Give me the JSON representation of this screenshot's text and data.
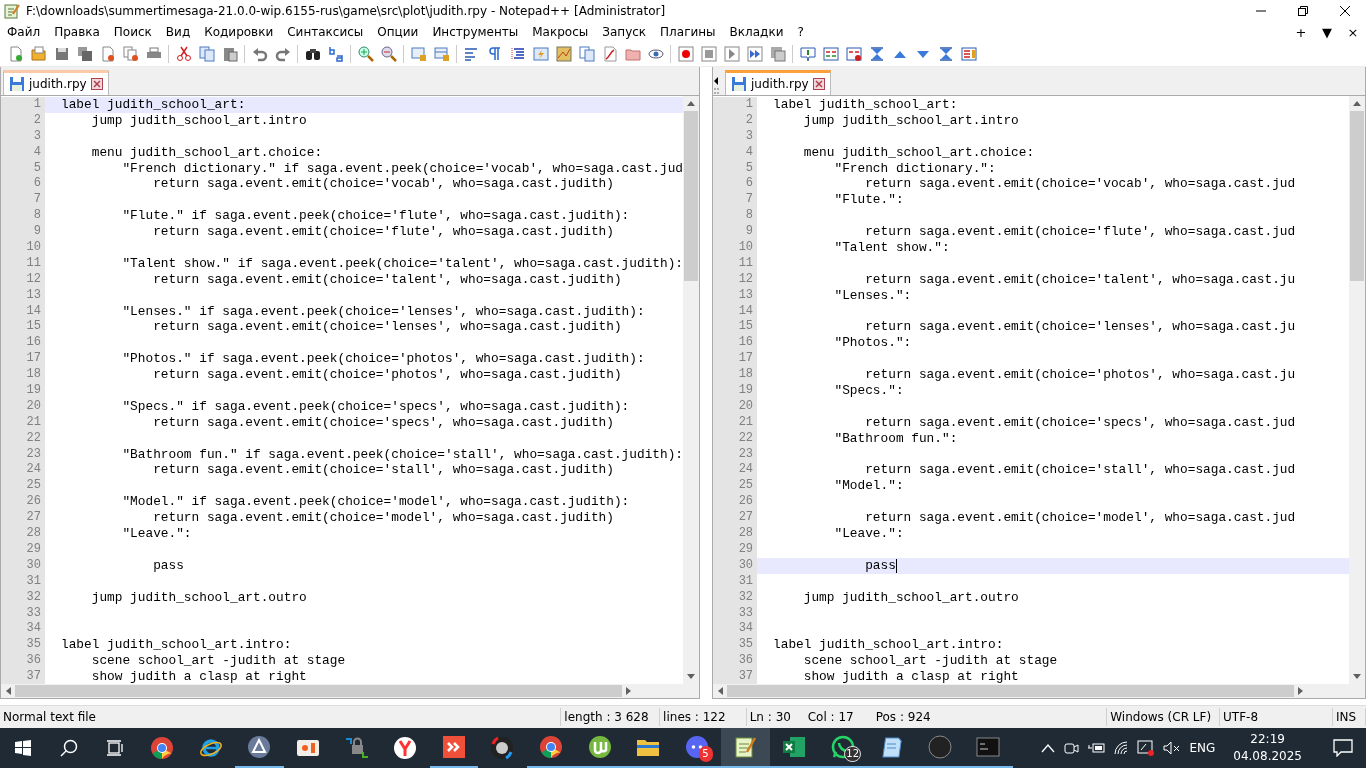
{
  "window": {
    "title": "F:\\downloads\\summertimesaga-21.0.0-wip.6155-rus\\game\\src\\plot\\judith.rpy - Notepad++ [Administrator]"
  },
  "menu": [
    "Файл",
    "Правка",
    "Поиск",
    "Вид",
    "Кодировки",
    "Синтаксисы",
    "Опции",
    "Инструменты",
    "Макросы",
    "Запуск",
    "Плагины",
    "Вкладки",
    "?"
  ],
  "menu_controls": [
    "+",
    "▼",
    "×"
  ],
  "panes": [
    {
      "tab": {
        "label": "judith.rpy",
        "selected": false
      },
      "lines": [
        {
          "n": "1",
          "text": "label judith_school_art:",
          "current": true
        },
        {
          "n": "2",
          "text": "    jump judith_school_art.intro",
          "current": false
        },
        {
          "n": "3",
          "current": false
        },
        {
          "n": "4",
          "text": "    menu judith_school_art.choice:",
          "current": false
        },
        {
          "n": "5",
          "text": "        \"French dictionary.\" if saga.event.peek(choice='vocab', who=saga.cast.jud",
          "current": false
        },
        {
          "n": "6",
          "text": "            return saga.event.emit(choice='vocab', who=saga.cast.judith)",
          "current": false
        },
        {
          "n": "7",
          "current": false
        },
        {
          "n": "8",
          "text": "        \"Flute.\" if saga.event.peek(choice='flute', who=saga.cast.judith):",
          "current": false
        },
        {
          "n": "9",
          "text": "            return saga.event.emit(choice='flute', who=saga.cast.judith)",
          "current": false
        },
        {
          "n": "10",
          "current": false
        },
        {
          "n": "11",
          "text": "        \"Talent show.\" if saga.event.peek(choice='talent', who=saga.cast.judith):",
          "current": false
        },
        {
          "n": "12",
          "text": "            return saga.event.emit(choice='talent', who=saga.cast.judith)",
          "current": false
        },
        {
          "n": "13",
          "current": false
        },
        {
          "n": "14",
          "text": "        \"Lenses.\" if saga.event.peek(choice='lenses', who=saga.cast.judith):",
          "current": false
        },
        {
          "n": "15",
          "text": "            return saga.event.emit(choice='lenses', who=saga.cast.judith)",
          "current": false
        },
        {
          "n": "16",
          "current": false
        },
        {
          "n": "17",
          "text": "        \"Photos.\" if saga.event.peek(choice='photos', who=saga.cast.judith):",
          "current": false
        },
        {
          "n": "18",
          "text": "            return saga.event.emit(choice='photos', who=saga.cast.judith)",
          "current": false
        },
        {
          "n": "19",
          "current": false
        },
        {
          "n": "20",
          "text": "        \"Specs.\" if saga.event.peek(choice='specs', who=saga.cast.judith):",
          "current": false
        },
        {
          "n": "21",
          "text": "            return saga.event.emit(choice='specs', who=saga.cast.judith)",
          "current": false
        },
        {
          "n": "22",
          "current": false
        },
        {
          "n": "23",
          "text": "        \"Bathroom fun.\" if saga.event.peek(choice='stall', who=saga.cast.judith):",
          "current": false
        },
        {
          "n": "24",
          "text": "            return saga.event.emit(choice='stall', who=saga.cast.judith)",
          "current": false
        },
        {
          "n": "25",
          "current": false
        },
        {
          "n": "26",
          "text": "        \"Model.\" if saga.event.peek(choice='model', who=saga.cast.judith):",
          "current": false
        },
        {
          "n": "27",
          "text": "            return saga.event.emit(choice='model', who=saga.cast.judith)",
          "current": false
        },
        {
          "n": "28",
          "text": "        \"Leave.\":",
          "current": false
        },
        {
          "n": "29",
          "current": false
        },
        {
          "n": "30",
          "text": "            pass",
          "current": false
        },
        {
          "n": "31",
          "current": false
        },
        {
          "n": "32",
          "text": "    jump judith_school_art.outro",
          "current": false
        },
        {
          "n": "33",
          "current": false
        },
        {
          "n": "34",
          "current": false
        },
        {
          "n": "35",
          "text": "label judith_school_art.intro:",
          "current": false
        },
        {
          "n": "36",
          "text": "    scene school_art -judith at stage",
          "current": false
        },
        {
          "n": "37",
          "text": "    show judith a clasp at right",
          "current": false
        }
      ]
    },
    {
      "tab": {
        "label": "judith.rpy",
        "selected": true
      },
      "lines": [
        {
          "n": "1",
          "text": "label judith_school_art:",
          "current": false
        },
        {
          "n": "2",
          "text": "    jump judith_school_art.intro",
          "current": false
        },
        {
          "n": "3",
          "current": false
        },
        {
          "n": "4",
          "text": "    menu judith_school_art.choice:",
          "current": false
        },
        {
          "n": "5",
          "text": "        \"French dictionary.\":",
          "current": false
        },
        {
          "n": "6",
          "text": "            return saga.event.emit(choice='vocab', who=saga.cast.jud",
          "current": false
        },
        {
          "n": "7",
          "text": "        \"Flute.\":",
          "current": false
        },
        {
          "n": "8",
          "current": false
        },
        {
          "n": "9",
          "text": "            return saga.event.emit(choice='flute', who=saga.cast.jud",
          "current": false
        },
        {
          "n": "10",
          "text": "        \"Talent show.\":",
          "current": false
        },
        {
          "n": "11",
          "current": false
        },
        {
          "n": "12",
          "text": "            return saga.event.emit(choice='talent', who=saga.cast.ju",
          "current": false
        },
        {
          "n": "13",
          "text": "        \"Lenses.\":",
          "current": false
        },
        {
          "n": "14",
          "current": false
        },
        {
          "n": "15",
          "text": "            return saga.event.emit(choice='lenses', who=saga.cast.ju",
          "current": false
        },
        {
          "n": "16",
          "text": "        \"Photos.\":",
          "current": false
        },
        {
          "n": "17",
          "current": false
        },
        {
          "n": "18",
          "text": "            return saga.event.emit(choice='photos', who=saga.cast.ju",
          "current": false
        },
        {
          "n": "19",
          "text": "        \"Specs.\":",
          "current": false
        },
        {
          "n": "20",
          "current": false
        },
        {
          "n": "21",
          "text": "            return saga.event.emit(choice='specs', who=saga.cast.jud",
          "current": false
        },
        {
          "n": "22",
          "text": "        \"Bathroom fun.\":",
          "current": false
        },
        {
          "n": "23",
          "current": false
        },
        {
          "n": "24",
          "text": "            return saga.event.emit(choice='stall', who=saga.cast.jud",
          "current": false
        },
        {
          "n": "25",
          "text": "        \"Model.\":",
          "current": false
        },
        {
          "n": "26",
          "current": false
        },
        {
          "n": "27",
          "text": "            return saga.event.emit(choice='model', who=saga.cast.jud",
          "current": false
        },
        {
          "n": "28",
          "text": "        \"Leave.\":",
          "current": false
        },
        {
          "n": "29",
          "current": false
        },
        {
          "n": "30",
          "text": "            pass",
          "current": true
        },
        {
          "n": "31",
          "current": false
        },
        {
          "n": "32",
          "text": "    jump judith_school_art.outro",
          "current": false
        },
        {
          "n": "33",
          "current": false
        },
        {
          "n": "34",
          "current": false
        },
        {
          "n": "35",
          "text": "label judith_school_art.intro:",
          "current": false
        },
        {
          "n": "36",
          "text": "    scene school_art -judith at stage",
          "current": false
        },
        {
          "n": "37",
          "text": "    show judith a clasp at right",
          "current": false
        }
      ]
    }
  ],
  "status_bar": {
    "file_type": "Normal text file",
    "length": "length : 3 628",
    "lines": "lines : 122",
    "line": "Ln : 30",
    "column": "Col : 17",
    "position": "Pos : 924",
    "line_endings": "Windows (CR LF)",
    "encoding": "UTF-8",
    "mode": "INS"
  },
  "taskbar": {
    "apps": [
      {
        "kind": "chrome",
        "running": false,
        "selected": false
      },
      {
        "kind": "ie",
        "running": false,
        "selected": false
      },
      {
        "kind": "disc",
        "running": true,
        "selected": false
      },
      {
        "kind": "photo",
        "running": false,
        "selected": false
      },
      {
        "kind": "lock",
        "running": false,
        "selected": false
      },
      {
        "kind": "y",
        "running": false,
        "selected": false
      },
      {
        "kind": "red",
        "running": true,
        "selected": false
      },
      {
        "kind": "media",
        "running": false,
        "selected": false
      },
      {
        "kind": "chrome",
        "running": true,
        "selected": false
      },
      {
        "kind": "torrent",
        "running": true,
        "selected": false
      },
      {
        "kind": "folder",
        "running": true,
        "selected": false
      },
      {
        "kind": "chat",
        "running": true,
        "selected": false,
        "badge": "5"
      },
      {
        "kind": "notepadpp",
        "running": true,
        "selected": true
      },
      {
        "kind": "excel",
        "running": true,
        "selected": false
      },
      {
        "kind": "phone",
        "running": true,
        "selected": false,
        "badge": "12"
      },
      {
        "kind": "notepad",
        "running": true,
        "selected": false
      },
      {
        "kind": "circle",
        "running": true,
        "selected": false
      },
      {
        "kind": "console",
        "running": true,
        "selected": false
      }
    ],
    "language": "ENG",
    "time": "22:19",
    "date": "04.08.2025"
  }
}
